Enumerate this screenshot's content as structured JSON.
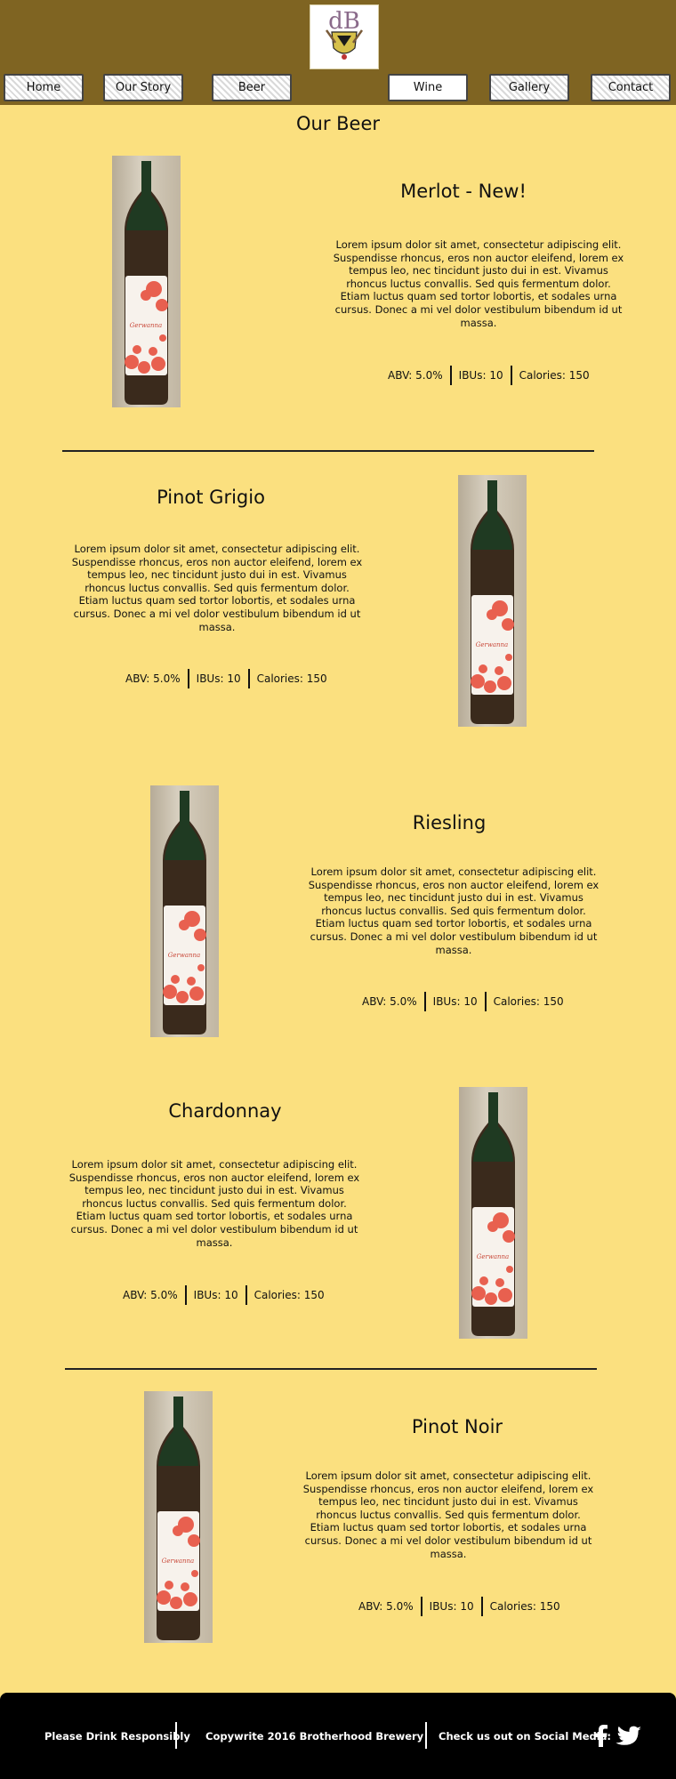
{
  "brand": {
    "logo_label": "dB"
  },
  "nav": {
    "items": [
      {
        "label": "Home",
        "active": false
      },
      {
        "label": "Our Story",
        "active": false
      },
      {
        "label": "Beer",
        "active": false
      },
      {
        "label": "Wine",
        "active": true
      },
      {
        "label": "Gallery",
        "active": false
      },
      {
        "label": "Contact",
        "active": false
      }
    ]
  },
  "page": {
    "title": "Our Beer"
  },
  "beers": [
    {
      "name": "Merlot - New!",
      "description": "Lorem ipsum dolor sit amet, consectetur adipiscing elit. Suspendisse rhoncus, eros non auctor eleifend, lorem ex tempus leo, nec tincidunt justo dui in est. Vivamus rhoncus luctus convallis. Sed quis fermentum dolor. Etiam luctus quam sed tortor lobortis, et sodales urna cursus. Donec a mi vel dolor vestibulum bibendum id ut massa.",
      "abv": "ABV: 5.0%",
      "ibus": "IBUs: 10",
      "calories": "Calories: 150",
      "bottle_label": "Gerwanna"
    },
    {
      "name": "Pinot Grigio",
      "description": "Lorem ipsum dolor sit amet, consectetur adipiscing elit. Suspendisse rhoncus, eros non auctor eleifend, lorem ex tempus leo, nec tincidunt justo dui in est. Vivamus rhoncus luctus convallis. Sed quis fermentum dolor. Etiam luctus quam sed tortor lobortis, et sodales urna cursus. Donec a mi vel dolor vestibulum bibendum id ut massa.",
      "abv": "ABV: 5.0%",
      "ibus": "IBUs: 10",
      "calories": "Calories: 150",
      "bottle_label": "Gerwanna"
    },
    {
      "name": "Riesling",
      "description": "Lorem ipsum dolor sit amet, consectetur adipiscing elit. Suspendisse rhoncus, eros non auctor eleifend, lorem ex tempus leo, nec tincidunt justo dui in est. Vivamus rhoncus luctus convallis. Sed quis fermentum dolor. Etiam luctus quam sed tortor lobortis, et sodales urna cursus. Donec a mi vel dolor vestibulum bibendum id ut massa.",
      "abv": "ABV: 5.0%",
      "ibus": "IBUs: 10",
      "calories": "Calories: 150",
      "bottle_label": "Gerwanna"
    },
    {
      "name": "Chardonnay",
      "description": "Lorem ipsum dolor sit amet, consectetur adipiscing elit. Suspendisse rhoncus, eros non auctor eleifend, lorem ex tempus leo, nec tincidunt justo dui in est. Vivamus rhoncus luctus convallis. Sed quis fermentum dolor. Etiam luctus quam sed tortor lobortis, et sodales urna cursus. Donec a mi vel dolor vestibulum bibendum id ut massa.",
      "abv": "ABV: 5.0%",
      "ibus": "IBUs: 10",
      "calories": "Calories: 150",
      "bottle_label": "Gerwanna"
    },
    {
      "name": "Pinot Noir",
      "description": "Lorem ipsum dolor sit amet, consectetur adipiscing elit. Suspendisse rhoncus, eros non auctor eleifend, lorem ex tempus leo, nec tincidunt justo dui in est. Vivamus rhoncus luctus convallis. Sed quis fermentum dolor. Etiam luctus quam sed tortor lobortis, et sodales urna cursus. Donec a mi vel dolor vestibulum bibendum id ut massa.",
      "abv": "ABV: 5.0%",
      "ibus": "IBUs: 10",
      "calories": "Calories: 150",
      "bottle_label": "Gerwanna"
    }
  ],
  "footer": {
    "responsibility": "Please Drink Responsibly",
    "copyright": "Copywrite 2016 Brotherhood Brewery",
    "social_prompt": "Check us out on Social Media:",
    "social_icons": [
      "facebook-icon",
      "twitter-icon"
    ]
  },
  "colors": {
    "background": "#fbe07f",
    "header": "#7f6422",
    "footer": "#000000",
    "bottle_label_flowers": "#e8604f",
    "bottle_glass": "#3a2a1c"
  }
}
